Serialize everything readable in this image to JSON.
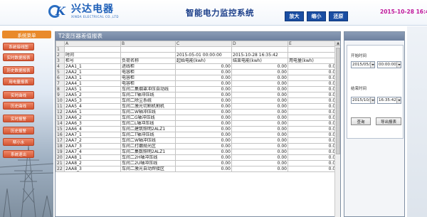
{
  "header": {
    "logo_en": "XINDA ELECTRICAL CO.,LTD",
    "logo_cn": "兴达电器",
    "app_title": "智能电力监控系统",
    "btn_zoom_in": "放大",
    "btn_zoom_out": "缩小",
    "btn_restore": "还原",
    "clock": "2015-10-28 16:4"
  },
  "sidebar": {
    "head": "系统菜单",
    "items": [
      {
        "label": "系统接线图"
      },
      {
        "label": "实时数据报表"
      },
      {
        "label": "历史数据报表"
      },
      {
        "label": "用电量报表"
      },
      {
        "label": "实时曲线"
      },
      {
        "label": "历史曲线"
      },
      {
        "label": "实时报警"
      },
      {
        "label": "历史报警"
      },
      {
        "label": "帮小水"
      },
      {
        "label": "系统退出"
      }
    ]
  },
  "panel": {
    "title": "T2变压器差值报表"
  },
  "sheet": {
    "col_letters": [
      "A",
      "B",
      "C",
      "D",
      "E"
    ],
    "header_rows": [
      {
        "rn": "1",
        "a": "",
        "b": "",
        "c": "",
        "d": "",
        "e": ""
      },
      {
        "rn": "2",
        "a": "时间",
        "b": "",
        "c": "2015-05-01 00:00:00",
        "d": "2015-10-28 16:35:42",
        "e": ""
      },
      {
        "rn": "3",
        "a": "柜号",
        "b": "负荷名称",
        "c": "起始电能(kwh)",
        "d": "结束电能(kwh)",
        "e": "用电量(kwh)"
      }
    ],
    "rows": [
      {
        "rn": "4",
        "a": "2AA1_1",
        "b": "进线柜",
        "c": "0.00",
        "d": "0.00",
        "e": "0.00"
      },
      {
        "rn": "5",
        "a": "2AA2_1",
        "b": "电容柜",
        "c": "0.00",
        "d": "0.00",
        "e": "0.00"
      },
      {
        "rn": "6",
        "a": "2AA3_1",
        "b": "电容柜",
        "c": "0.00",
        "d": "0.00",
        "e": "0.00"
      },
      {
        "rn": "7",
        "a": "2AA4_1",
        "b": "电容柜",
        "c": "0.00",
        "d": "0.00",
        "e": "0.00"
      },
      {
        "rn": "8",
        "a": "2AA5_1",
        "b": "车间二集烟罩冲压自动线",
        "c": "0.00",
        "d": "0.00",
        "e": "0.00"
      },
      {
        "rn": "9",
        "a": "2AA5_2",
        "b": "车间二T轴冲压线",
        "c": "0.00",
        "d": "0.00",
        "e": "0.00"
      },
      {
        "rn": "10",
        "a": "2AA5_3",
        "b": "车间二除尘系统",
        "c": "0.00",
        "d": "0.00",
        "e": "0.00"
      },
      {
        "rn": "11",
        "a": "2AA5_4",
        "b": "车间二激光切割机割机",
        "c": "0.00",
        "d": "0.00",
        "e": "0.00"
      },
      {
        "rn": "12",
        "a": "2AA6_1",
        "b": "车间二W轴冲压线",
        "c": "0.00",
        "d": "0.00",
        "e": "0.00"
      },
      {
        "rn": "13",
        "a": "2AA6_2",
        "b": "车间二G轴冲压线",
        "c": "0.00",
        "d": "0.00",
        "e": "0.00"
      },
      {
        "rn": "14",
        "a": "2AA6_3",
        "b": "车间二L轴冲压线",
        "c": "0.00",
        "d": "0.00",
        "e": "0.00"
      },
      {
        "rn": "15",
        "a": "2AA6_4",
        "b": "车间二建筑照明2ALZ1",
        "c": "0.00",
        "d": "0.00",
        "e": "0.00"
      },
      {
        "rn": "16",
        "a": "2AA7_1",
        "b": "车间二T轴冲压线",
        "c": "0.00",
        "d": "0.00",
        "e": "0.00"
      },
      {
        "rn": "17",
        "a": "2AA7_2",
        "b": "车间二W轴冲压线",
        "c": "0.00",
        "d": "0.00",
        "e": "0.00"
      },
      {
        "rn": "18",
        "a": "2AA7_3",
        "b": "车间二打磨抛光区",
        "c": "0.00",
        "d": "0.00",
        "e": "0.00"
      },
      {
        "rn": "19",
        "a": "2AA7_4",
        "b": "车间二集数照明2ALZ1",
        "c": "0.00",
        "d": "0.00",
        "e": "0.00"
      },
      {
        "rn": "20",
        "a": "2AA8_1",
        "b": "车间二2H轴冲压线",
        "c": "0.00",
        "d": "0.00",
        "e": "0.00"
      },
      {
        "rn": "21",
        "a": "2AA8_2",
        "b": "车间二2U轴冲压线",
        "c": "0.00",
        "d": "0.00",
        "e": "0.00"
      },
      {
        "rn": "22",
        "a": "2AA8_3",
        "b": "车间二激光自动焊接区",
        "c": "0.00",
        "d": "0.00",
        "e": "0.00"
      }
    ]
  },
  "query": {
    "start_label": "开始时间",
    "start_date": "2015/05/01",
    "start_time": "00:00:00",
    "end_label": "结束时间",
    "end_date": "2015/10/28",
    "end_time": "16:35:42",
    "btn_query": "查询",
    "btn_export": "导出报表"
  },
  "colors": {
    "menu_head": "#e98a2a",
    "menu_item": "#d45533",
    "header_btn": "#1a4ea3",
    "clock": "#c0169a",
    "title_text": "#1c3f8a"
  }
}
